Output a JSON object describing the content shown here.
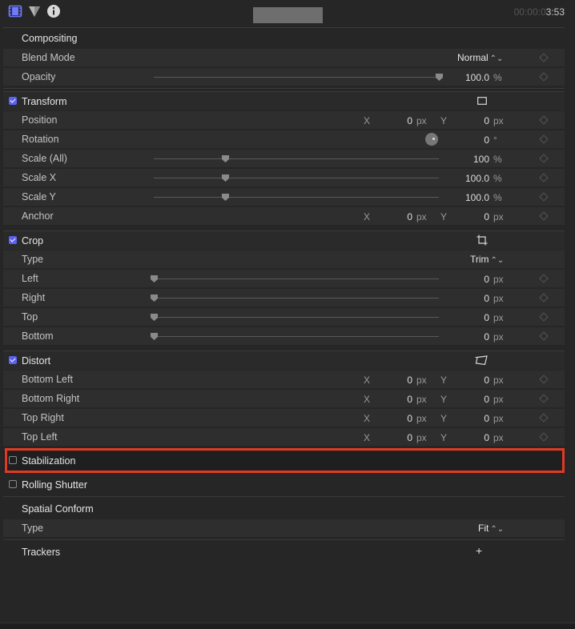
{
  "header": {
    "icons": [
      "film-icon",
      "filter-icon",
      "info-icon"
    ],
    "timecode_dim": "00:00:0",
    "timecode_lit": "3:53"
  },
  "compositing": {
    "title": "Compositing",
    "blend_mode": {
      "label": "Blend Mode",
      "value": "Normal"
    },
    "opacity": {
      "label": "Opacity",
      "value": "100.0",
      "unit": "%",
      "slider_fraction": 1.0
    }
  },
  "transform": {
    "title": "Transform",
    "checked": true,
    "icon": "transform-rect-icon",
    "position": {
      "label": "Position",
      "x_axis": "X",
      "x": "0",
      "x_unit": "px",
      "y_axis": "Y",
      "y": "0",
      "y_unit": "px"
    },
    "rotation": {
      "label": "Rotation",
      "value": "0",
      "unit": "°"
    },
    "scale_all": {
      "label": "Scale (All)",
      "value": "100",
      "unit": "%",
      "slider_fraction": 0.25
    },
    "scale_x": {
      "label": "Scale X",
      "value": "100.0",
      "unit": "%",
      "slider_fraction": 0.25
    },
    "scale_y": {
      "label": "Scale Y",
      "value": "100.0",
      "unit": "%",
      "slider_fraction": 0.25
    },
    "anchor": {
      "label": "Anchor",
      "x_axis": "X",
      "x": "0",
      "x_unit": "px",
      "y_axis": "Y",
      "y": "0",
      "y_unit": "px"
    }
  },
  "crop": {
    "title": "Crop",
    "checked": true,
    "icon": "crop-icon",
    "type": {
      "label": "Type",
      "value": "Trim"
    },
    "left": {
      "label": "Left",
      "value": "0",
      "unit": "px",
      "slider_fraction": 0
    },
    "right": {
      "label": "Right",
      "value": "0",
      "unit": "px",
      "slider_fraction": 0
    },
    "top": {
      "label": "Top",
      "value": "0",
      "unit": "px",
      "slider_fraction": 0
    },
    "bottom": {
      "label": "Bottom",
      "value": "0",
      "unit": "px",
      "slider_fraction": 0
    }
  },
  "distort": {
    "title": "Distort",
    "checked": true,
    "icon": "distort-icon",
    "points": [
      {
        "label": "Bottom Left",
        "x_axis": "X",
        "x": "0",
        "x_unit": "px",
        "y_axis": "Y",
        "y": "0",
        "y_unit": "px"
      },
      {
        "label": "Bottom Right",
        "x_axis": "X",
        "x": "0",
        "x_unit": "px",
        "y_axis": "Y",
        "y": "0",
        "y_unit": "px"
      },
      {
        "label": "Top Right",
        "x_axis": "X",
        "x": "0",
        "x_unit": "px",
        "y_axis": "Y",
        "y": "0",
        "y_unit": "px"
      },
      {
        "label": "Top Left",
        "x_axis": "X",
        "x": "0",
        "x_unit": "px",
        "y_axis": "Y",
        "y": "0",
        "y_unit": "px"
      }
    ]
  },
  "stabilization": {
    "title": "Stabilization",
    "checked": false
  },
  "rolling_shutter": {
    "title": "Rolling Shutter",
    "checked": false
  },
  "spatial_conform": {
    "title": "Spatial Conform",
    "type": {
      "label": "Type",
      "value": "Fit"
    }
  },
  "trackers": {
    "title": "Trackers",
    "add_icon": "plus-icon"
  },
  "colors": {
    "accent": "#5b62f0",
    "highlight": "#e03a24",
    "background": "#262626"
  }
}
